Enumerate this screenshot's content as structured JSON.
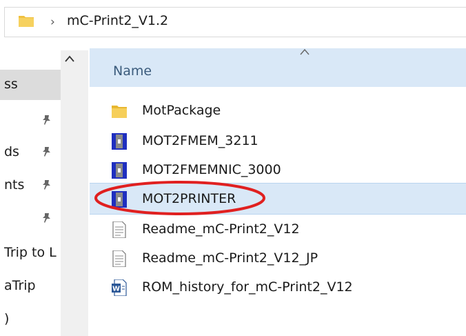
{
  "address": {
    "path": "mC-Print2_V1.2"
  },
  "nav": {
    "items": [
      {
        "label": "ss",
        "selected": true,
        "pinned": false
      },
      {
        "label": "",
        "pinned": true
      },
      {
        "label": "ds",
        "pinned": true
      },
      {
        "label": "nts",
        "pinned": true
      },
      {
        "label": "",
        "pinned": true
      },
      {
        "label": "Trip to L",
        "pinned": false
      },
      {
        "label": "aTrip",
        "pinned": false
      },
      {
        "label": ")",
        "pinned": false
      }
    ]
  },
  "list": {
    "column_header": "Name",
    "files": [
      {
        "name": "MotPackage",
        "icon": "folder-icon"
      },
      {
        "name": "MOT2FMEM_3211",
        "icon": "application-icon"
      },
      {
        "name": "MOT2FMEMNIC_3000",
        "icon": "application-icon"
      },
      {
        "name": "MOT2PRINTER",
        "icon": "application-icon",
        "selected": true,
        "circled": true
      },
      {
        "name": "Readme_mC-Print2_V12",
        "icon": "text-document-icon"
      },
      {
        "name": "Readme_mC-Print2_V12_JP",
        "icon": "text-document-icon"
      },
      {
        "name": "ROM_history_for_mC-Print2_V12",
        "icon": "word-document-icon"
      }
    ]
  },
  "colors": {
    "selection": "#d9e8f7",
    "folder": "#f0c03f",
    "app_icon": "#1f2fbf",
    "annotation": "#e02020"
  }
}
